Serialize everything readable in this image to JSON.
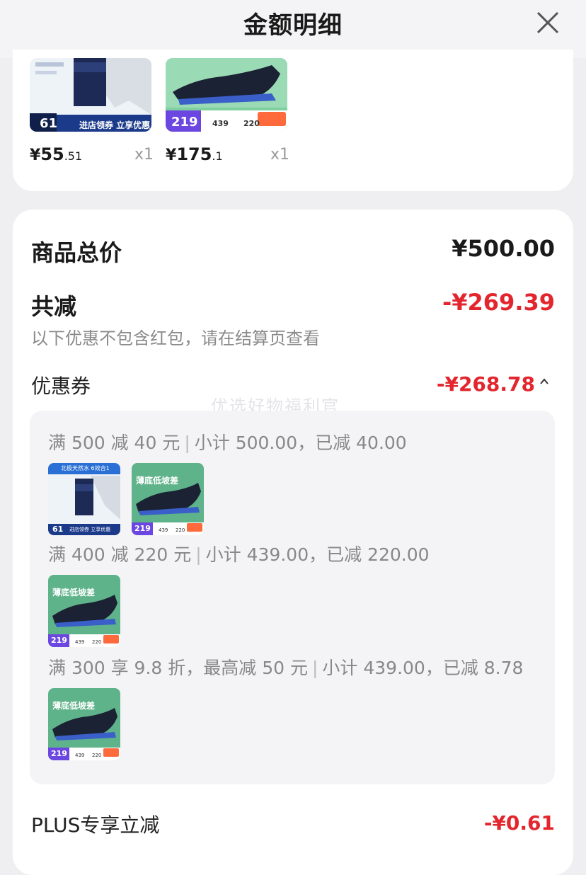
{
  "header": {
    "title": "金额明细"
  },
  "products": [
    {
      "price_yen": "¥",
      "price_int": "55",
      "price_dec": ".51",
      "qty": "x1",
      "badge": "61",
      "banner": "进店领券 立享优惠"
    },
    {
      "price_yen": "¥",
      "price_int": "175",
      "price_dec": ".1",
      "qty": "x1",
      "badge": "219",
      "sub1": "439",
      "sub2": "220"
    }
  ],
  "summary": {
    "total_label": "商品总价",
    "total_value": "¥500.00",
    "discount_label": "共减",
    "discount_value": "-¥269.39",
    "discount_note": "以下优惠不包含红包，请在结算页查看",
    "coupon_label": "优惠券",
    "coupon_value": "-¥268.78",
    "watermark": "优选好物福利官"
  },
  "coupon_rules": [
    {
      "condition": "满 500 减 40 元",
      "detail": "小计 500.00，已减 40.00"
    },
    {
      "condition": "满 400 减 220 元",
      "detail": "小计 439.00，已减 220.00"
    },
    {
      "condition": "满 300 享 9.8 折，最高减 50 元",
      "detail": "小计 439.00，已减 8.78"
    }
  ],
  "thumb_text": {
    "cream_title": "北极天然水 6效合1",
    "cream_badge": "61",
    "cream_banner": "进店领券 立享优惠",
    "shoe_title": "薄底低坡差",
    "shoe_badge": "219",
    "shoe_sub1": "439",
    "shoe_sub2": "220"
  },
  "plus": {
    "label": "PLUS专享立减",
    "value": "-¥0.61"
  },
  "colors": {
    "accent_red": "#e3262e",
    "shoe_green": "#5fb38a",
    "badge_purple": "#6b46e0"
  }
}
